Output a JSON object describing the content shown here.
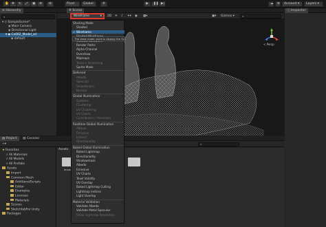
{
  "toolbar": {
    "pivot": "Pivot",
    "global": "Global",
    "account": "Account",
    "layers": "Layers"
  },
  "hierarchy": {
    "tab": "Hierarchy",
    "items": [
      {
        "label": "SampleScene*"
      },
      {
        "label": "Main Camera"
      },
      {
        "label": "Directional Light"
      },
      {
        "label": "Cx002_Model_sd"
      },
      {
        "label": "default"
      }
    ]
  },
  "scene": {
    "tab": "Scene",
    "draw_mode": "Wireframe",
    "gizmos": "Gizmos",
    "persp_label": "< Persp",
    "tooltip": "The draw mode used to display the Scene."
  },
  "inspector": {
    "tab": "Inspector"
  },
  "draw_menu": {
    "items": [
      {
        "label": "Shading Mode",
        "type": "head"
      },
      {
        "label": "Shaded",
        "type": "item"
      },
      {
        "label": "Wireframe",
        "type": "sel"
      },
      {
        "label": "Shaded Wireframe",
        "type": "item"
      },
      {
        "label": "Shadow Cascades",
        "type": "item"
      },
      {
        "label": "Render Paths",
        "type": "item"
      },
      {
        "label": "Alpha Channel",
        "type": "item"
      },
      {
        "label": "Overdraw",
        "type": "item"
      },
      {
        "label": "Mipmaps",
        "type": "item"
      },
      {
        "label": "Texture Streaming",
        "type": "dim"
      },
      {
        "label": "Sprite Mask",
        "type": "item"
      },
      {
        "label": "Deferred",
        "type": "head"
      },
      {
        "label": "Albedo",
        "type": "dim"
      },
      {
        "label": "Specular",
        "type": "dim"
      },
      {
        "label": "Smoothness",
        "type": "dim"
      },
      {
        "label": "Normal",
        "type": "dim"
      },
      {
        "label": "Global Illumination",
        "type": "head"
      },
      {
        "label": "Systems",
        "type": "dim"
      },
      {
        "label": "Clustering",
        "type": "dim"
      },
      {
        "label": "UV Clustering",
        "type": "dim"
      },
      {
        "label": "UV Charts",
        "type": "dim"
      },
      {
        "label": "Contributors / Receivers",
        "type": "dim"
      },
      {
        "label": "Realtime Global Illumination",
        "type": "head"
      },
      {
        "label": "Albedo",
        "type": "dim"
      },
      {
        "label": "Emissive",
        "type": "dim"
      },
      {
        "label": "Indirect",
        "type": "dim"
      },
      {
        "label": "Directionality",
        "type": "dim"
      },
      {
        "label": "Baked Global Illumination",
        "type": "head"
      },
      {
        "label": "Baked Lightmap",
        "type": "item"
      },
      {
        "label": "Directionality",
        "type": "item"
      },
      {
        "label": "Shadowmask",
        "type": "item"
      },
      {
        "label": "Albedo",
        "type": "item"
      },
      {
        "label": "Emissive",
        "type": "item"
      },
      {
        "label": "UV Charts",
        "type": "item"
      },
      {
        "label": "Texel Validity",
        "type": "item"
      },
      {
        "label": "UV Overlap",
        "type": "item"
      },
      {
        "label": "Baked Lightmap Culling",
        "type": "item"
      },
      {
        "label": "Lightmap Indices",
        "type": "item"
      },
      {
        "label": "Light Overlap",
        "type": "item"
      },
      {
        "label": "Material Validation",
        "type": "head"
      },
      {
        "label": "Validate Albedo",
        "type": "item"
      },
      {
        "label": "Validate Metal Specular",
        "type": "item"
      },
      {
        "label": "Show Lightmap Resolution",
        "type": "dim"
      }
    ]
  },
  "project": {
    "tabs": [
      "Project",
      "Console"
    ],
    "tree": [
      {
        "label": "Favorites",
        "kind": "star",
        "indent": 0
      },
      {
        "label": "All Materials",
        "kind": "search",
        "indent": 1
      },
      {
        "label": "All Models",
        "kind": "search",
        "indent": 1
      },
      {
        "label": "All Prefabs",
        "kind": "search",
        "indent": 1
      },
      {
        "label": "Assets",
        "kind": "folder",
        "indent": 0
      },
      {
        "label": "Import",
        "kind": "folder",
        "indent": 1
      },
      {
        "label": "Common Mesh",
        "kind": "folder",
        "indent": 1
      },
      {
        "label": "AdditionalScripts",
        "kind": "folder",
        "indent": 2
      },
      {
        "label": "Editor",
        "kind": "folder",
        "indent": 2
      },
      {
        "label": "Examples",
        "kind": "folder",
        "indent": 2
      },
      {
        "label": "Licenses",
        "kind": "folder",
        "indent": 2
      },
      {
        "label": "Materials",
        "kind": "folder",
        "indent": 2
      },
      {
        "label": "Scenes",
        "kind": "folder",
        "indent": 1
      },
      {
        "label": "SketchfabFor Unity",
        "kind": "folder",
        "indent": 1
      },
      {
        "label": "Packages",
        "kind": "folder",
        "indent": 0
      }
    ],
    "breadcrumb": "Assets",
    "assets": [
      {
        "label": "Import"
      }
    ]
  },
  "colors": {
    "selection": "#2c5d87",
    "highlight_box": "#e03a2f",
    "folder": "#c8a854"
  }
}
